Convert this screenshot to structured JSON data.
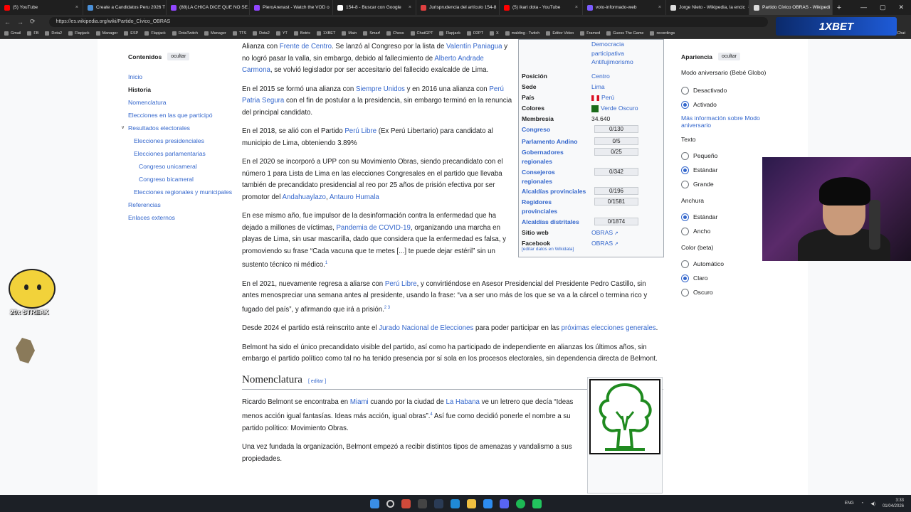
{
  "browser": {
    "tabs": [
      {
        "title": "(5) YouTube",
        "color": "#ff0000",
        "active": false
      },
      {
        "title": "Create a Candidatos Peru 2026 T",
        "color": "#4a90d9",
        "active": false
      },
      {
        "title": "(88)LA CHICA DICE QUE NO SE A",
        "color": "#9146ff",
        "active": false
      },
      {
        "title": "PieroArenast - Watch the VOD o",
        "color": "#9146ff",
        "active": false
      },
      {
        "title": "154-8 - Buscar con Google",
        "color": "#ffffff",
        "active": false
      },
      {
        "title": "Jurisprudencia del artículo 154-8",
        "color": "#e04040",
        "active": false
      },
      {
        "title": "(5) ikari dota - YouTube",
        "color": "#ff0000",
        "active": false
      },
      {
        "title": "voto-informado-web",
        "color": "#7b5cff",
        "active": false
      },
      {
        "title": "Jorge Nieto - Wikipedia, la encic",
        "color": "#dddddd",
        "active": false
      },
      {
        "title": "Partido Cívico OBRAS - Wikipedi",
        "color": "#dddddd",
        "active": true
      }
    ],
    "url": "https://es.wikipedia.org/wiki/Partido_Cívico_OBRAS",
    "bookmarks": [
      "Gmail",
      "FB",
      "Dota2",
      "Flapjack",
      "Manager",
      "ESP",
      "Flapjack",
      "DotaTwitch",
      "Manager",
      "TTS",
      "Dota2",
      "YT",
      "Botrix",
      "1XBET",
      "Main",
      "Smarf",
      "Chess",
      "ChatGPT",
      "Flapjack",
      "D2PT",
      "X",
      "malding - Twitch",
      "Editor Video",
      "Framed",
      "Guess The Game",
      "recordings"
    ],
    "ad_text": "1XBET",
    "chat_label": "Chat"
  },
  "toc": {
    "title": "Contenidos",
    "hide": "ocultar",
    "items": [
      {
        "label": "Inicio",
        "level": 1
      },
      {
        "label": "Historia",
        "level": 1,
        "current": true
      },
      {
        "label": "Nomenclatura",
        "level": 1
      },
      {
        "label": "Elecciones en las que participó",
        "level": 1
      },
      {
        "label": "Resultados electorales",
        "level": 1
      },
      {
        "label": "Elecciones presidenciales",
        "level": 2
      },
      {
        "label": "Elecciones parlamentarias",
        "level": 2
      },
      {
        "label": "Congreso unicameral",
        "level": 3
      },
      {
        "label": "Congreso bicameral",
        "level": 3
      },
      {
        "label": "Elecciones regionales y municipales",
        "level": 2
      },
      {
        "label": "Referencias",
        "level": 1
      },
      {
        "label": "Enlaces externos",
        "level": 1
      }
    ]
  },
  "article": {
    "p1a": "Alianza con ",
    "p1b": "Frente de Centro",
    "p1c": ". Se lanzó al Congreso por la lista de ",
    "p1d": "Valentín Paniagua",
    "p1e": " y no logró pasar la valla, sin embargo, debido al fallecimiento de ",
    "p1f": "Alberto Andrade Carmona",
    "p1g": ", se volvió legislador por ser accesitario del fallecido exalcalde de Lima.",
    "p2a": "En el 2015 se formó una alianza con ",
    "p2b": "Siempre Unidos",
    "p2c": " y en 2016 una alianza con ",
    "p2d": "Perú Patria Segura",
    "p2e": " con el fin de postular a la presidencia, sin embargo terminó en la renuncia del principal candidato.",
    "p3a": "En el 2018, se alió con el Partido ",
    "p3b": "Perú Libre",
    "p3c": " (Ex Perú Libertario) para candidato al municipio de Lima, obteniendo 3.89%",
    "p4a": "En el 2020 se incorporó a UPP con su Movimiento Obras, siendo precandidato con el número 1 para Lista de Lima en las elecciones Congresales en el partido que llevaba también de precandidato presidencial al reo por 25 años de prisión efectiva por ser promotor del ",
    "p4b": "Andahuaylazo",
    "p4c": ", ",
    "p4d": "Antauro Humala",
    "p5a": "En ese mismo año, fue impulsor de la desinformación contra la enfermedad que ha dejado a millones de víctimas, ",
    "p5b": "Pandemia de COVID-19",
    "p5c": ", organizando una marcha en playas de Lima, sin usar mascarilla, dado que considera que la enfermedad es falsa, y promoviendo su frase “Cada vacuna que te metes [...] te puede dejar estéril” sin un sustento técnico ni médico.",
    "p5s": "1",
    "p6a": "En el 2021, nuevamente regresa a aliarse con ",
    "p6b": "Perú Libre",
    "p6c": ", y convirtiéndose en Asesor Presidencial del Presidente Pedro Castillo, sin antes menospreciar una semana antes al presidente, usando la frase: “va a ser uno más de los que se va a la cárcel o termina rico y fugado del país”, y afirmando que irá a prisión.",
    "p6s": "2 3",
    "p7a": "Desde 2024 el partido está reinscrito ante el ",
    "p7b": "Jurado Nacional de Elecciones",
    "p7c": " para poder participar en las ",
    "p7d": "próximas elecciones generales",
    "p8": "Belmont ha sido el único precandidato visible del partido, así como ha participado de independiente en alianzas los últimos años, sin embargo el partido político como tal no ha tenido presencia por sí sola en los procesos electorales, sin dependencia directa de Belmont.",
    "h_nom": "Nomenclatura",
    "edit": "[ editar ]",
    "n1a": "Ricardo Belmont se encontraba en ",
    "n1b": "Miami",
    "n1c": " cuando por la ciudad de ",
    "n1d": "La Habana",
    "n1e": " ve un letrero que decía “Ideas menos acción igual fantasías. Ideas más acción, igual obras”.",
    "n1s": "4",
    "n1f": "  Así fue como decidió ponerle el nombre a su partido político: Movimiento Obras.",
    "n2": "Una vez fundada la organización, Belmont empezó a recibir distintos tipos de amenazas y vandalismo a sus propiedades."
  },
  "infobox": {
    "ideology": [
      "Democracia",
      "participativa",
      "Antifujimorismo"
    ],
    "rows": [
      {
        "label": "Posición",
        "value": "Centro",
        "link": true
      },
      {
        "label": "Sede",
        "value": "Lima",
        "link": true
      },
      {
        "label": "País",
        "value": "Perú",
        "link": true
      },
      {
        "label": "Colores",
        "value": "Verde Oscuro",
        "link": true
      },
      {
        "label": "Membresía",
        "value": "34.640",
        "link": false
      }
    ],
    "seats": [
      {
        "label": "Congreso",
        "value": "0/130",
        "fraction": 0
      },
      {
        "label": "Parlamento Andino",
        "value": "0/5",
        "fraction": 0
      },
      {
        "label": "Gobernadores regionales",
        "value": "0/25",
        "fraction": 0
      },
      {
        "label": "Consejeros regionales",
        "value": "0/342",
        "fraction": 0
      },
      {
        "label": "Alcaldías provinciales",
        "value": "0/196",
        "fraction": 0
      },
      {
        "label": "Regidores provinciales",
        "value": "0/1581",
        "fraction": 0
      },
      {
        "label": "Alcaldías distritales",
        "value": "0/1874",
        "fraction": 0
      }
    ],
    "web_label": "Sitio web",
    "web": "OBRAS",
    "fb_label": "Facebook",
    "fb": "OBRAS",
    "edit": "[editar datos en Wikidata]",
    "party_color": "#1a6b1a"
  },
  "appearance": {
    "title": "Apariencia",
    "hide": "ocultar",
    "mode_label": "Modo aniversario (Bebé Globo)",
    "mode_opts": [
      {
        "label": "Desactivado",
        "on": false
      },
      {
        "label": "Activado",
        "on": true
      }
    ],
    "mode_link": "Más información sobre Modo aniversario",
    "text_label": "Texto",
    "text_opts": [
      {
        "label": "Pequeño",
        "on": false
      },
      {
        "label": "Estándar",
        "on": true
      },
      {
        "label": "Grande",
        "on": false
      }
    ],
    "width_label": "Anchura",
    "width_opts": [
      {
        "label": "Estándar",
        "on": true
      },
      {
        "label": "Ancho",
        "on": false
      }
    ],
    "color_label": "Color (beta)",
    "color_opts": [
      {
        "label": "Automático",
        "on": false
      },
      {
        "label": "Claro",
        "on": true
      },
      {
        "label": "Oscuro",
        "on": false
      }
    ]
  },
  "overlay": {
    "streak": "20x STREAK"
  },
  "taskbar": {
    "lang": "ENG",
    "time": "3:33",
    "date": "01/04/2026"
  }
}
